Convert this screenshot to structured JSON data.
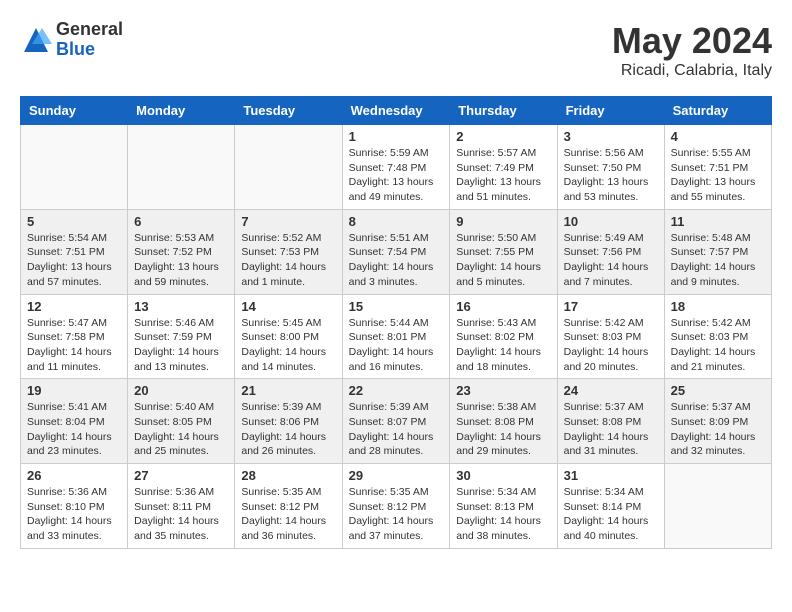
{
  "logo": {
    "general": "General",
    "blue": "Blue"
  },
  "title": {
    "month_year": "May 2024",
    "location": "Ricadi, Calabria, Italy"
  },
  "headers": [
    "Sunday",
    "Monday",
    "Tuesday",
    "Wednesday",
    "Thursday",
    "Friday",
    "Saturday"
  ],
  "weeks": [
    [
      {
        "day": "",
        "info": ""
      },
      {
        "day": "",
        "info": ""
      },
      {
        "day": "",
        "info": ""
      },
      {
        "day": "1",
        "info": "Sunrise: 5:59 AM\nSunset: 7:48 PM\nDaylight: 13 hours\nand 49 minutes."
      },
      {
        "day": "2",
        "info": "Sunrise: 5:57 AM\nSunset: 7:49 PM\nDaylight: 13 hours\nand 51 minutes."
      },
      {
        "day": "3",
        "info": "Sunrise: 5:56 AM\nSunset: 7:50 PM\nDaylight: 13 hours\nand 53 minutes."
      },
      {
        "day": "4",
        "info": "Sunrise: 5:55 AM\nSunset: 7:51 PM\nDaylight: 13 hours\nand 55 minutes."
      }
    ],
    [
      {
        "day": "5",
        "info": "Sunrise: 5:54 AM\nSunset: 7:51 PM\nDaylight: 13 hours\nand 57 minutes."
      },
      {
        "day": "6",
        "info": "Sunrise: 5:53 AM\nSunset: 7:52 PM\nDaylight: 13 hours\nand 59 minutes."
      },
      {
        "day": "7",
        "info": "Sunrise: 5:52 AM\nSunset: 7:53 PM\nDaylight: 14 hours\nand 1 minute."
      },
      {
        "day": "8",
        "info": "Sunrise: 5:51 AM\nSunset: 7:54 PM\nDaylight: 14 hours\nand 3 minutes."
      },
      {
        "day": "9",
        "info": "Sunrise: 5:50 AM\nSunset: 7:55 PM\nDaylight: 14 hours\nand 5 minutes."
      },
      {
        "day": "10",
        "info": "Sunrise: 5:49 AM\nSunset: 7:56 PM\nDaylight: 14 hours\nand 7 minutes."
      },
      {
        "day": "11",
        "info": "Sunrise: 5:48 AM\nSunset: 7:57 PM\nDaylight: 14 hours\nand 9 minutes."
      }
    ],
    [
      {
        "day": "12",
        "info": "Sunrise: 5:47 AM\nSunset: 7:58 PM\nDaylight: 14 hours\nand 11 minutes."
      },
      {
        "day": "13",
        "info": "Sunrise: 5:46 AM\nSunset: 7:59 PM\nDaylight: 14 hours\nand 13 minutes."
      },
      {
        "day": "14",
        "info": "Sunrise: 5:45 AM\nSunset: 8:00 PM\nDaylight: 14 hours\nand 14 minutes."
      },
      {
        "day": "15",
        "info": "Sunrise: 5:44 AM\nSunset: 8:01 PM\nDaylight: 14 hours\nand 16 minutes."
      },
      {
        "day": "16",
        "info": "Sunrise: 5:43 AM\nSunset: 8:02 PM\nDaylight: 14 hours\nand 18 minutes."
      },
      {
        "day": "17",
        "info": "Sunrise: 5:42 AM\nSunset: 8:03 PM\nDaylight: 14 hours\nand 20 minutes."
      },
      {
        "day": "18",
        "info": "Sunrise: 5:42 AM\nSunset: 8:03 PM\nDaylight: 14 hours\nand 21 minutes."
      }
    ],
    [
      {
        "day": "19",
        "info": "Sunrise: 5:41 AM\nSunset: 8:04 PM\nDaylight: 14 hours\nand 23 minutes."
      },
      {
        "day": "20",
        "info": "Sunrise: 5:40 AM\nSunset: 8:05 PM\nDaylight: 14 hours\nand 25 minutes."
      },
      {
        "day": "21",
        "info": "Sunrise: 5:39 AM\nSunset: 8:06 PM\nDaylight: 14 hours\nand 26 minutes."
      },
      {
        "day": "22",
        "info": "Sunrise: 5:39 AM\nSunset: 8:07 PM\nDaylight: 14 hours\nand 28 minutes."
      },
      {
        "day": "23",
        "info": "Sunrise: 5:38 AM\nSunset: 8:08 PM\nDaylight: 14 hours\nand 29 minutes."
      },
      {
        "day": "24",
        "info": "Sunrise: 5:37 AM\nSunset: 8:08 PM\nDaylight: 14 hours\nand 31 minutes."
      },
      {
        "day": "25",
        "info": "Sunrise: 5:37 AM\nSunset: 8:09 PM\nDaylight: 14 hours\nand 32 minutes."
      }
    ],
    [
      {
        "day": "26",
        "info": "Sunrise: 5:36 AM\nSunset: 8:10 PM\nDaylight: 14 hours\nand 33 minutes."
      },
      {
        "day": "27",
        "info": "Sunrise: 5:36 AM\nSunset: 8:11 PM\nDaylight: 14 hours\nand 35 minutes."
      },
      {
        "day": "28",
        "info": "Sunrise: 5:35 AM\nSunset: 8:12 PM\nDaylight: 14 hours\nand 36 minutes."
      },
      {
        "day": "29",
        "info": "Sunrise: 5:35 AM\nSunset: 8:12 PM\nDaylight: 14 hours\nand 37 minutes."
      },
      {
        "day": "30",
        "info": "Sunrise: 5:34 AM\nSunset: 8:13 PM\nDaylight: 14 hours\nand 38 minutes."
      },
      {
        "day": "31",
        "info": "Sunrise: 5:34 AM\nSunset: 8:14 PM\nDaylight: 14 hours\nand 40 minutes."
      },
      {
        "day": "",
        "info": ""
      }
    ]
  ]
}
